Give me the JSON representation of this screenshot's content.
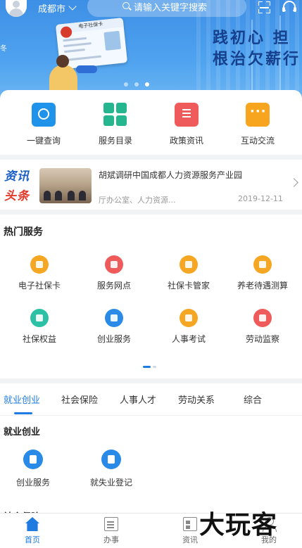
{
  "topbar": {
    "city": "成都市",
    "search_placeholder": "请输入关键字搜索",
    "icons": [
      "avatar-icon",
      "chevron-down-icon",
      "search-icon",
      "scan-icon",
      "headset-icon"
    ]
  },
  "banner": {
    "slogan_line1": "践初心  担",
    "slogan_line2": "根治欠薪行",
    "card_title": "电子社保卡",
    "slides": 3,
    "active_slide": 3,
    "colors": {
      "sky": "#4fa3ef",
      "slogan": "#163f8c"
    }
  },
  "quick": [
    {
      "label": "一键查询",
      "icon": "search-square-icon",
      "color": "#1f93ea"
    },
    {
      "label": "服务目录",
      "icon": "grid-icon",
      "color": "#25b68f"
    },
    {
      "label": "政策资讯",
      "icon": "document-icon",
      "color": "#ef5a5a"
    },
    {
      "label": "互动交流",
      "icon": "chat-bubble-icon",
      "color": "#f7a51e"
    }
  ],
  "news": {
    "brand_line1": "资讯",
    "brand_line2": "头条",
    "title": "胡斌调研中国成都人力资源服务产业园",
    "source": "厅办公室、人力资源...",
    "date": "2019-12-11"
  },
  "hot": {
    "heading": "热门服务",
    "items": [
      {
        "label": "电子社保卡",
        "icon": "id-card-icon",
        "color": "#f5a623"
      },
      {
        "label": "服务网点",
        "icon": "location-pin-icon",
        "color": "#ef5a5a"
      },
      {
        "label": "社保卡管家",
        "icon": "card-manager-icon",
        "color": "#f5a623"
      },
      {
        "label": "养老待遇测算",
        "icon": "box-icon",
        "color": "#f5a623"
      },
      {
        "label": "社保权益",
        "icon": "shield-icon",
        "color": "#2cc1a4"
      },
      {
        "label": "创业服务",
        "icon": "money-bag-icon",
        "color": "#2a8ae8"
      },
      {
        "label": "人事考试",
        "icon": "exam-icon",
        "color": "#f5a623"
      },
      {
        "label": "劳动监察",
        "icon": "inspect-icon",
        "color": "#ef5a5a"
      }
    ],
    "page": 1,
    "pages": 2
  },
  "categories": {
    "tabs": [
      "就业创业",
      "社会保险",
      "人事人才",
      "劳动关系",
      "综合"
    ],
    "active_tab": 0,
    "section1_title": "就业创业",
    "section1_items": [
      {
        "label": "创业服务",
        "icon": "money-bag-icon"
      },
      {
        "label": "就失业登记",
        "icon": "briefcase-icon"
      }
    ],
    "section2_title": "社会保险"
  },
  "bottom_nav": [
    {
      "label": "首页",
      "icon": "home-icon",
      "active": true
    },
    {
      "label": "办事",
      "icon": "document-icon",
      "active": false
    },
    {
      "label": "资讯",
      "icon": "newspaper-icon",
      "active": false
    },
    {
      "label": "我的",
      "icon": "user-icon",
      "active": false
    }
  ],
  "watermark": "大玩客",
  "accent_color": "#1f7be0"
}
